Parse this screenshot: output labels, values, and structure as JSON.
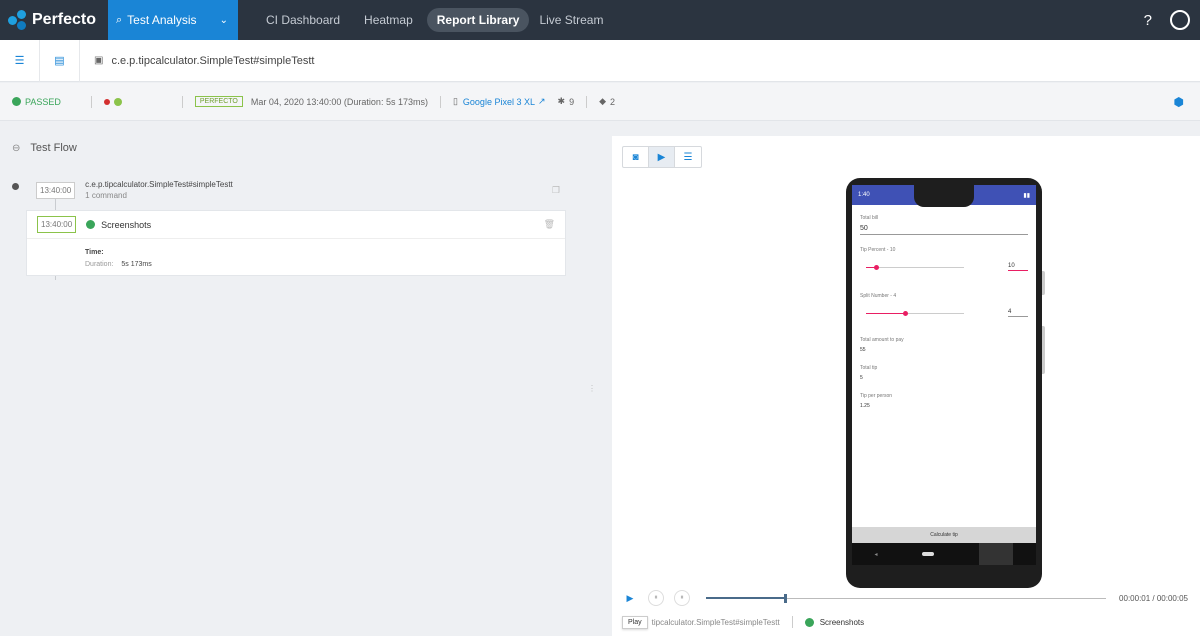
{
  "nav": {
    "logo": "Perfecto",
    "active": "Test Analysis",
    "items": [
      "CI Dashboard",
      "Heatmap",
      "Report Library",
      "Live Stream"
    ],
    "help": "?"
  },
  "breadcrumb": {
    "title": "c.e.p.tipcalculator.SimpleTest#simpleTestt"
  },
  "status": {
    "result": "PASSED",
    "badge": "PERFECTO",
    "datetime": "Mar 04, 2020 13:40:00 (Duration: 5s 173ms)",
    "device": "Google Pixel 3 XL",
    "os_version": "9",
    "tags": "2"
  },
  "testflow": {
    "title": "Test Flow",
    "command_time": "13:40:00",
    "command_name": "c.e.p.tipcalculator.SimpleTest#simpleTestt",
    "command_count": "1 command",
    "shot_time": "13:40:00",
    "shot_title": "Screenshots",
    "time_label": "Time:",
    "duration_label": "Duration:",
    "duration_value": "5s 173ms"
  },
  "app": {
    "status_time": "1:40",
    "total_bill_label": "Total bill",
    "total_bill_value": "50",
    "tip_percent_label": "Tip Percent - 10",
    "tip_percent_value": "10",
    "tip_percent_fraction": 0.1,
    "split_label": "Split Number - 4",
    "split_value": "4",
    "split_fraction": 0.4,
    "total_pay_label": "Total amount to pay",
    "total_pay_value": "55",
    "total_tip_label": "Total tip",
    "total_tip_value": "5",
    "tip_per_person_label": "Tip per person",
    "tip_per_person_value": "1.25",
    "calc_button": "Calculate tip"
  },
  "player": {
    "time": "00:00:01 / 00:00:05",
    "progress": 0.2,
    "tooltip": "Play",
    "crumb": "tipcalculator.SimpleTest#simpleTestt",
    "step": "Screenshots"
  },
  "colors": {
    "nav_bg": "#2b3440",
    "accent": "#1a85d6",
    "passed": "#3aa55a"
  }
}
